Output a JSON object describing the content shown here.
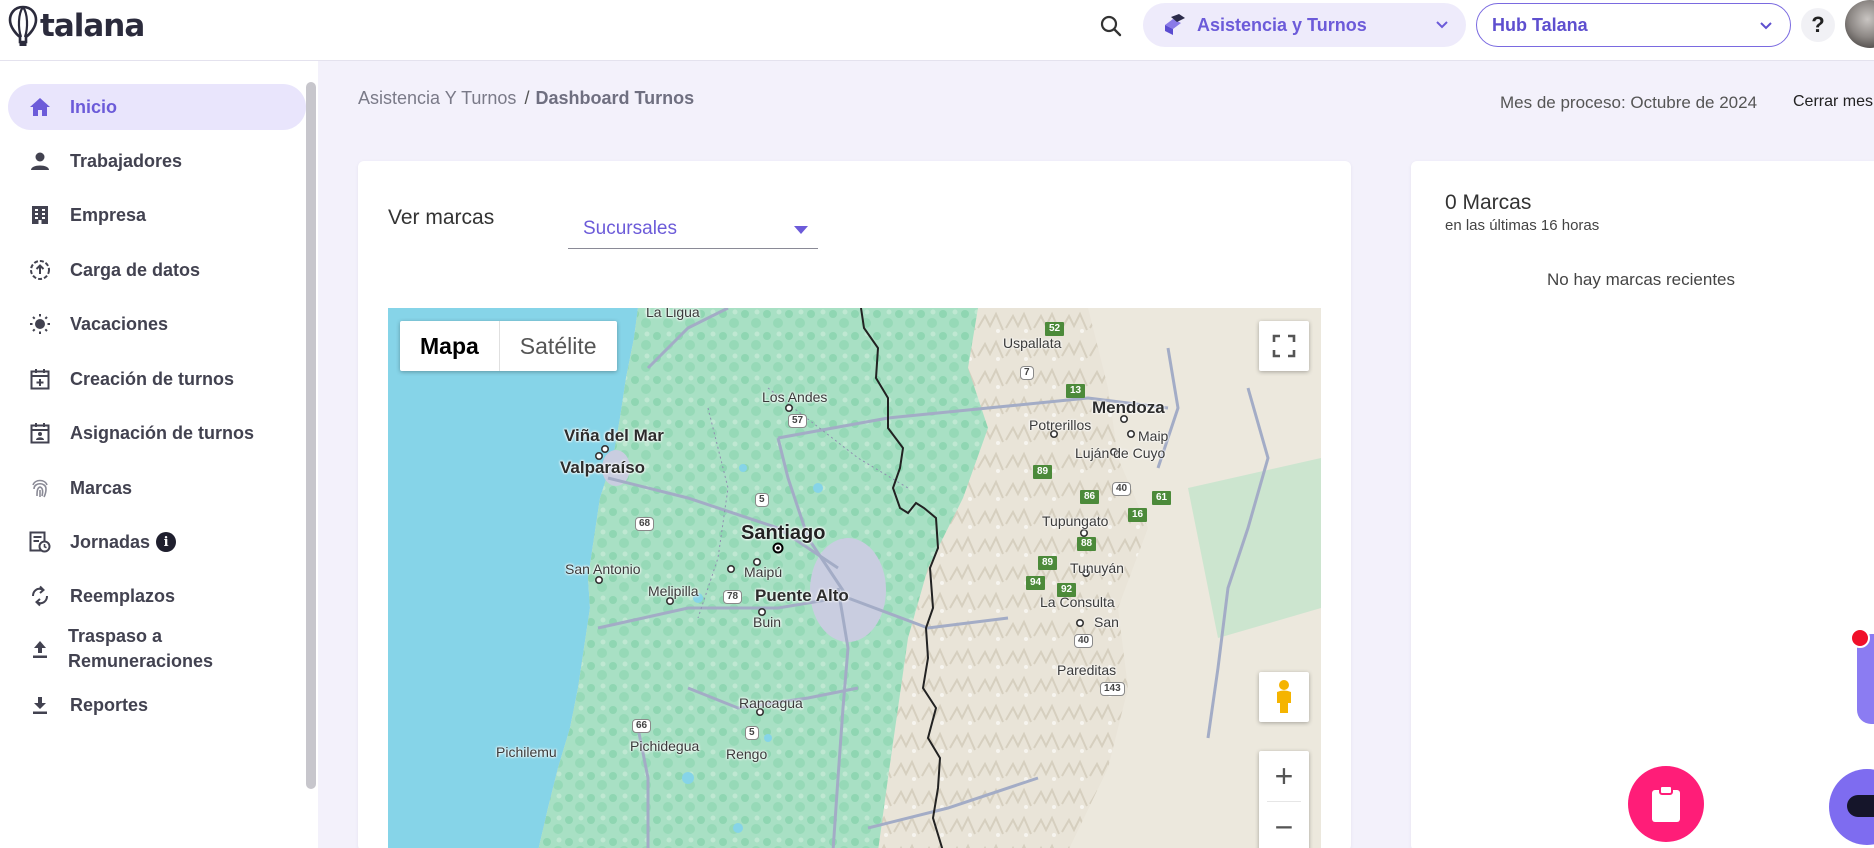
{
  "app": {
    "logo_text": "talana"
  },
  "header": {
    "search_icon": "search-icon",
    "module_label": "Asistencia y Turnos",
    "hub_label": "Hub Talana",
    "help_label": "?"
  },
  "sidebar": {
    "items": [
      {
        "label": "Inicio",
        "icon": "home-icon"
      },
      {
        "label": "Trabajadores",
        "icon": "person-icon"
      },
      {
        "label": "Empresa",
        "icon": "building-icon"
      },
      {
        "label": "Carga de datos",
        "icon": "upload-circle-icon"
      },
      {
        "label": "Vacaciones",
        "icon": "sun-icon"
      },
      {
        "label": "Creación de turnos",
        "icon": "calendar-plus-icon"
      },
      {
        "label": "Asignación de turnos",
        "icon": "calendar-person-icon"
      },
      {
        "label": "Marcas",
        "icon": "fingerprint-icon"
      },
      {
        "label": "Jornadas",
        "icon": "report-clock-icon",
        "badge": "i"
      },
      {
        "label": "Reemplazos",
        "icon": "sync-icon"
      },
      {
        "label": "Traspaso a Remuneraciones",
        "label_line1": "Traspaso a",
        "label_line2": "Remuneraciones",
        "icon": "upload-icon"
      },
      {
        "label": "Reportes",
        "icon": "download-icon"
      }
    ]
  },
  "breadcrumb": {
    "parent": "Asistencia Y Turnos",
    "separator": "/",
    "current": "Dashboard Turnos"
  },
  "process": {
    "month_text": "Mes de proceso: Octubre de 2024",
    "close_label": "Cerrar mes"
  },
  "main": {
    "view_label": "Ver marcas",
    "select_value": "Sucursales",
    "map": {
      "type_options": [
        "Mapa",
        "Satélite"
      ],
      "selected_type": "Mapa",
      "zoom_in": "+",
      "zoom_out": "−",
      "places": {
        "la_ligua": "La Ligua",
        "uspallata": "Uspallata",
        "los_andes": "Los Andes",
        "mendoza": "Mendoza",
        "vina": "Viña del Mar",
        "valparaiso": "Valparaíso",
        "potrerillos": "Potrerillos",
        "maipu_ar": "Maip",
        "lujan": "Luján de Cuyo",
        "santiago": "Santiago",
        "tupungato": "Tupungato",
        "san_antonio": "San Antonio",
        "maipu": "Maipú",
        "tunuyan": "Tunuyán",
        "melipilla": "Melipilla",
        "puente_alto": "Puente Alto",
        "la_consulta": "La Consulta",
        "buin": "Buin",
        "san": "San",
        "pareditas": "Pareditas",
        "rancagua": "Rancagua",
        "pichidegua": "Pichidegua",
        "pichilemu": "Pichilemu",
        "rengo": "Rengo"
      },
      "routes": {
        "r52": "52",
        "r7": "7",
        "r13": "13",
        "r57": "57",
        "r89a": "89",
        "r86": "86",
        "r40a": "40",
        "r61": "61",
        "r5a": "5",
        "r16": "16",
        "r68": "68",
        "r88": "88",
        "r89b": "89",
        "r94": "94",
        "r92": "92",
        "r78": "78",
        "r40b": "40",
        "r143": "143",
        "r66": "66",
        "r5b": "5"
      }
    }
  },
  "recent": {
    "count_text": "0 Marcas",
    "subtitle": "en las últimas 16 horas",
    "empty_text": "No hay marcas recientes"
  },
  "colors": {
    "brand": "#6c5bd9",
    "active_bg": "#e9e5fc",
    "fab": "#ff1d78",
    "background": "#f3f1fb"
  }
}
